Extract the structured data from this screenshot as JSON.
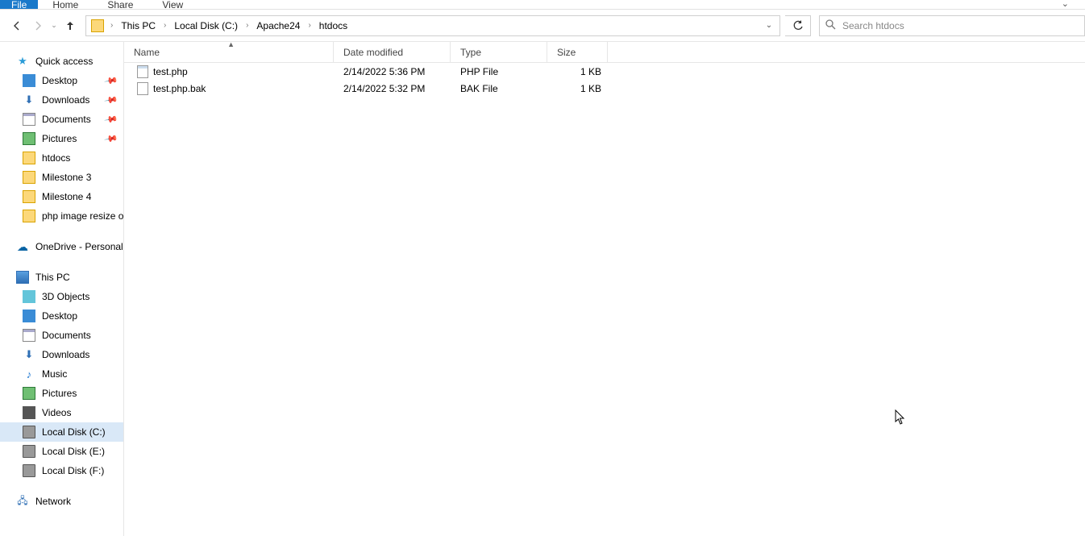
{
  "ribbon": {
    "file": "File",
    "home": "Home",
    "share": "Share",
    "view": "View"
  },
  "breadcrumbs": [
    "This PC",
    "Local Disk (C:)",
    "Apache24",
    "htdocs"
  ],
  "search": {
    "placeholder": "Search htdocs"
  },
  "sidebar": {
    "quick_access": "Quick access",
    "qa_items": [
      {
        "label": "Desktop",
        "icon": "desktop",
        "pinned": true
      },
      {
        "label": "Downloads",
        "icon": "downarrow",
        "pinned": true
      },
      {
        "label": "Documents",
        "icon": "doc",
        "pinned": true
      },
      {
        "label": "Pictures",
        "icon": "pic",
        "pinned": true
      },
      {
        "label": "htdocs",
        "icon": "folder",
        "pinned": false
      },
      {
        "label": "Milestone 3",
        "icon": "folder",
        "pinned": false
      },
      {
        "label": "Milestone 4",
        "icon": "folder",
        "pinned": false
      },
      {
        "label": "php image resize or",
        "icon": "folder",
        "pinned": false
      }
    ],
    "onedrive": "OneDrive - Personal",
    "this_pc": "This PC",
    "pc_items": [
      {
        "label": "3D Objects",
        "icon": "threed"
      },
      {
        "label": "Desktop",
        "icon": "desktop"
      },
      {
        "label": "Documents",
        "icon": "doc"
      },
      {
        "label": "Downloads",
        "icon": "downarrow"
      },
      {
        "label": "Music",
        "icon": "music"
      },
      {
        "label": "Pictures",
        "icon": "pic"
      },
      {
        "label": "Videos",
        "icon": "video"
      },
      {
        "label": "Local Disk (C:)",
        "icon": "disk",
        "selected": true
      },
      {
        "label": "Local Disk (E:)",
        "icon": "disk"
      },
      {
        "label": "Local Disk (F:)",
        "icon": "disk"
      }
    ],
    "network": "Network"
  },
  "columns": {
    "name": "Name",
    "date": "Date modified",
    "type": "Type",
    "size": "Size"
  },
  "files": [
    {
      "name": "test.php",
      "date": "2/14/2022 5:36 PM",
      "type": "PHP File",
      "size": "1 KB",
      "plain": false
    },
    {
      "name": "test.php.bak",
      "date": "2/14/2022 5:32 PM",
      "type": "BAK File",
      "size": "1 KB",
      "plain": true
    }
  ]
}
